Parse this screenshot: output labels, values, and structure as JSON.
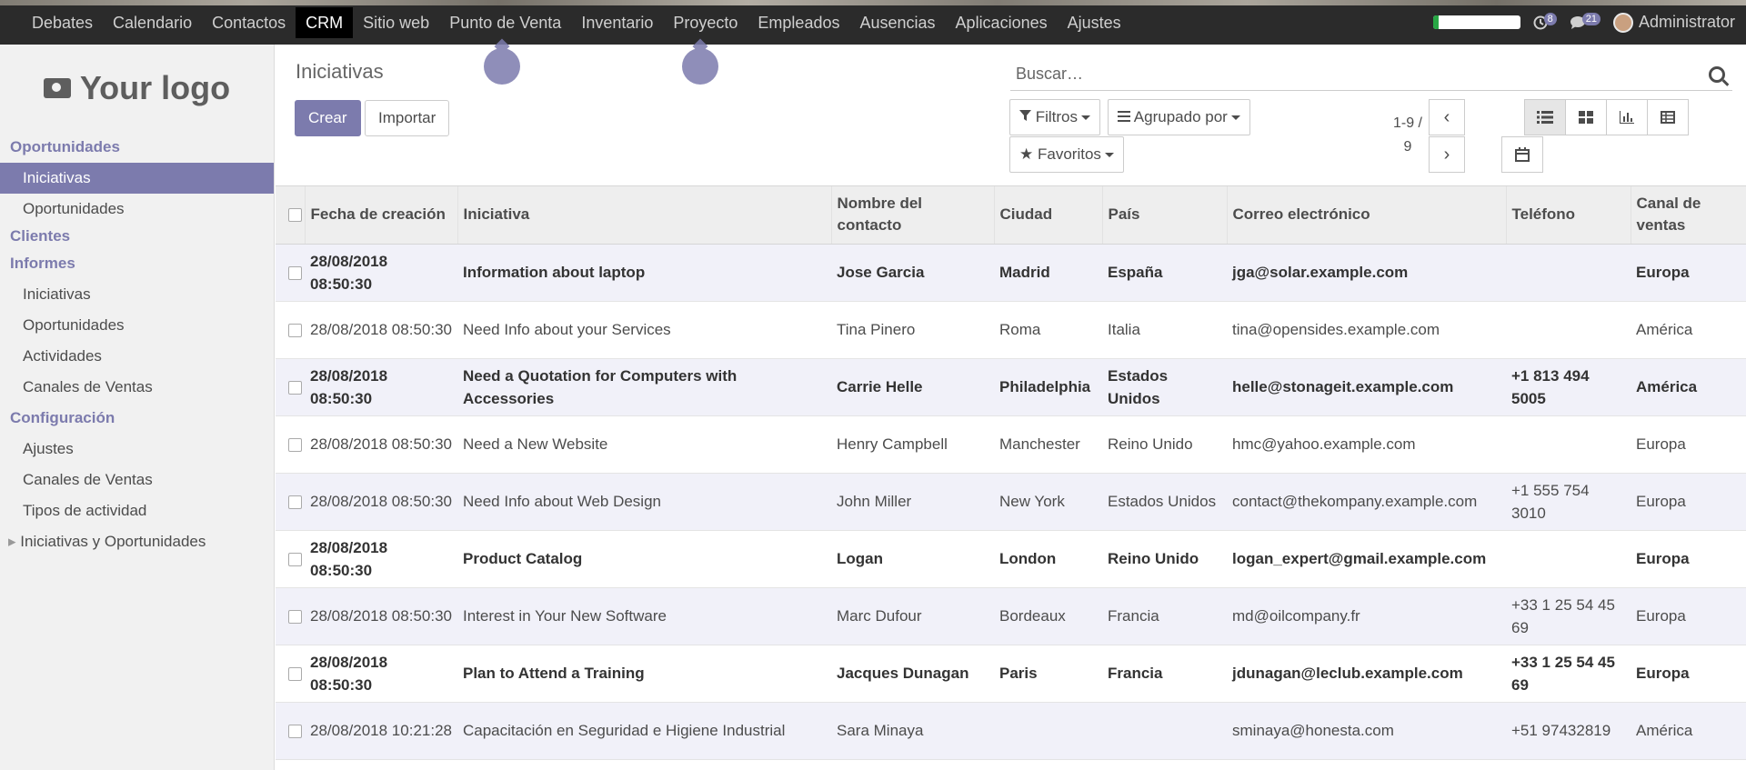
{
  "topbar": {
    "menus": [
      "Debates",
      "Calendario",
      "Contactos",
      "CRM",
      "Sitio web",
      "Punto de Venta",
      "Inventario",
      "Proyecto",
      "Empleados",
      "Ausencias",
      "Aplicaciones",
      "Ajustes"
    ],
    "active_menu": "CRM",
    "activity_count": "8",
    "message_count": "21",
    "user": "Administrator"
  },
  "sidebar": {
    "logo_text": "Your logo",
    "sections": [
      {
        "title": "Oportunidades",
        "items": [
          "Iniciativas",
          "Oportunidades"
        ]
      },
      {
        "title": "Clientes",
        "items": []
      },
      {
        "title": "Informes",
        "items": [
          "Iniciativas",
          "Oportunidades",
          "Actividades",
          "Canales de Ventas"
        ]
      },
      {
        "title": "Configuración",
        "items": [
          "Ajustes",
          "Canales de Ventas",
          "Tipos de actividad",
          "Iniciativas y Oportunidades"
        ]
      }
    ],
    "active_item": "Iniciativas"
  },
  "control_panel": {
    "title": "Iniciativas",
    "create_label": "Crear",
    "import_label": "Importar",
    "search_placeholder": "Buscar…",
    "filters_label": "Filtros",
    "groupby_label": "Agrupado por",
    "favorites_label": "Favoritos",
    "pager_range": "1-9 /",
    "pager_total": "9"
  },
  "table": {
    "columns": [
      "Fecha de creación",
      "Iniciativa",
      "Nombre del contacto",
      "Ciudad",
      "País",
      "Correo electrónico",
      "Teléfono",
      "Canal de ventas"
    ],
    "rows": [
      {
        "bold": true,
        "cells": [
          "28/08/2018 08:50:30",
          "Information about laptop",
          "Jose Garcia",
          "Madrid",
          "España",
          "jga@solar.example.com",
          "",
          "Europa"
        ]
      },
      {
        "bold": false,
        "cells": [
          "28/08/2018 08:50:30",
          "Need Info about your Services",
          "Tina Pinero",
          "Roma",
          "Italia",
          "tina@opensides.example.com",
          "",
          "América"
        ]
      },
      {
        "bold": true,
        "cells": [
          "28/08/2018 08:50:30",
          "Need a Quotation for Computers with Accessories",
          "Carrie Helle",
          "Philadelphia",
          "Estados Unidos",
          "helle@stonageit.example.com",
          "+1 813 494 5005",
          "América"
        ]
      },
      {
        "bold": false,
        "cells": [
          "28/08/2018 08:50:30",
          "Need a New Website",
          "Henry Campbell",
          "Manchester",
          "Reino Unido",
          "hmc@yahoo.example.com",
          "",
          "Europa"
        ]
      },
      {
        "bold": false,
        "cells": [
          "28/08/2018 08:50:30",
          "Need Info about Web Design",
          "John Miller",
          "New York",
          "Estados Unidos",
          "contact@thekompany.example.com",
          "+1 555 754 3010",
          "Europa"
        ]
      },
      {
        "bold": true,
        "cells": [
          "28/08/2018 08:50:30",
          "Product Catalog",
          "Logan",
          "London",
          "Reino Unido",
          "logan_expert@gmail.example.com",
          "",
          "Europa"
        ]
      },
      {
        "bold": false,
        "cells": [
          "28/08/2018 08:50:30",
          "Interest in Your New Software",
          "Marc Dufour",
          "Bordeaux",
          "Francia",
          "md@oilcompany.fr",
          "+33 1 25 54 45 69",
          "Europa"
        ]
      },
      {
        "bold": true,
        "cells": [
          "28/08/2018 08:50:30",
          "Plan to Attend a Training",
          "Jacques Dunagan",
          "Paris",
          "Francia",
          "jdunagan@leclub.example.com",
          "+33 1 25 54 45 69",
          "Europa"
        ]
      },
      {
        "bold": false,
        "cells": [
          "28/08/2018 10:21:28",
          "Capacitación en Seguridad e Higiene Industrial",
          "Sara Minaya",
          "",
          "",
          "sminaya@honesta.com",
          "+51 97432819",
          "América"
        ]
      }
    ]
  },
  "colors": {
    "accent": "#7c7bad",
    "topbar": "#2b2b2b"
  },
  "progress_fraction": 0.07
}
